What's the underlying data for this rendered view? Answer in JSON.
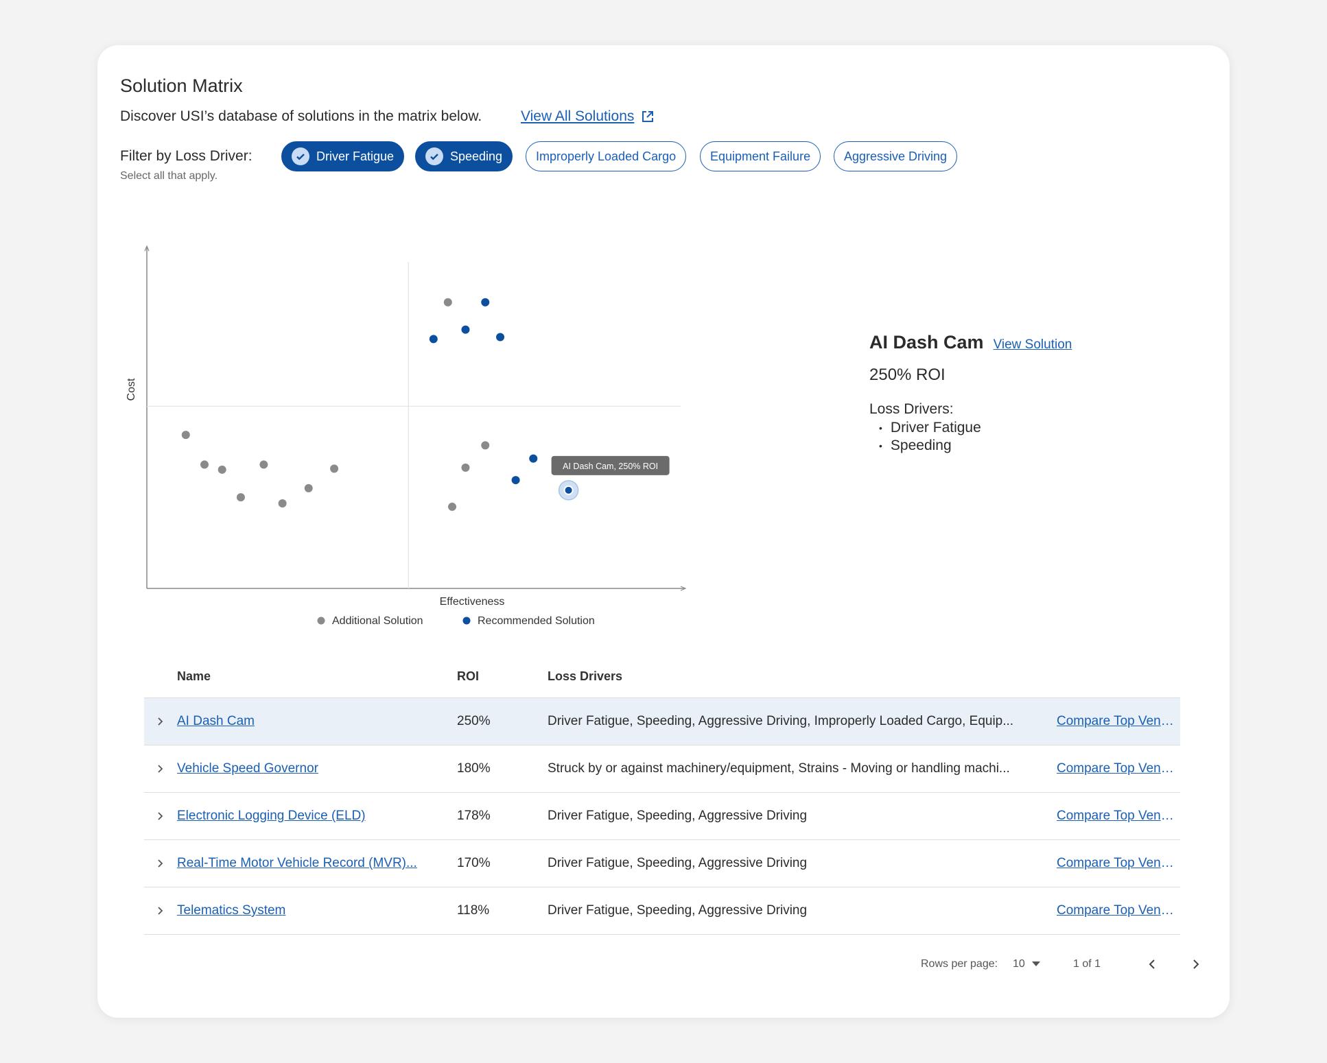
{
  "header": {
    "title": "Solution Matrix",
    "subtitle": "Discover USI’s database of solutions in the matrix below.",
    "view_all_label": "View All Solutions"
  },
  "filters": {
    "label": "Filter by Loss Driver:",
    "hint": "Select all that apply.",
    "chips": [
      {
        "label": "Driver Fatigue",
        "selected": true
      },
      {
        "label": "Speeding",
        "selected": true
      },
      {
        "label": "Improperly Loaded Cargo",
        "selected": false
      },
      {
        "label": "Equipment Failure",
        "selected": false
      },
      {
        "label": "Aggressive Driving",
        "selected": false
      }
    ]
  },
  "chart_data": {
    "type": "scatter",
    "xlabel": "Effectiveness",
    "ylabel": "Cost",
    "xlim": [
      0,
      100
    ],
    "ylim": [
      0,
      100
    ],
    "grid": false,
    "quadrant_lines": {
      "x": 49,
      "y": 54
    },
    "legend_placement": "bottom-center",
    "series": [
      {
        "name": "Additional Solution",
        "color": "#8a8a8a",
        "points": [
          {
            "x": 7.3,
            "y": 45.5
          },
          {
            "x": 10.8,
            "y": 36.7
          },
          {
            "x": 14.1,
            "y": 35.2
          },
          {
            "x": 17.6,
            "y": 27.0
          },
          {
            "x": 21.9,
            "y": 36.7
          },
          {
            "x": 25.4,
            "y": 25.2
          },
          {
            "x": 30.3,
            "y": 29.7
          },
          {
            "x": 35.1,
            "y": 35.5
          },
          {
            "x": 56.4,
            "y": 84.8
          },
          {
            "x": 59.7,
            "y": 35.8
          },
          {
            "x": 57.2,
            "y": 24.2
          },
          {
            "x": 63.4,
            "y": 42.4
          }
        ]
      },
      {
        "name": "Recommended Solution",
        "color": "#0b4f9e",
        "points": [
          {
            "x": 53.7,
            "y": 73.9
          },
          {
            "x": 59.7,
            "y": 76.7
          },
          {
            "x": 63.4,
            "y": 84.8
          },
          {
            "x": 66.2,
            "y": 74.5
          },
          {
            "x": 69.1,
            "y": 32.1
          },
          {
            "x": 72.4,
            "y": 38.5
          },
          {
            "x": 79.0,
            "y": 29.1,
            "active": true
          }
        ]
      }
    ],
    "tooltip": "AI Dash Cam, 250% ROI"
  },
  "detail": {
    "name": "AI Dash Cam",
    "view_label": "View Solution",
    "roi": "250% ROI",
    "loss_drivers_label": "Loss Drivers:",
    "loss_drivers": [
      "Driver Fatigue",
      "Speeding"
    ]
  },
  "table": {
    "columns": {
      "name": "Name",
      "roi": "ROI",
      "loss_drivers": "Loss Drivers"
    },
    "rows": [
      {
        "name": "AI Dash Cam",
        "roi": "250%",
        "loss_drivers": "Driver Fatigue, Speeding, Aggressive Driving, Improperly Loaded Cargo, Equip...",
        "action": "Compare Top Vendors",
        "highlight": true
      },
      {
        "name": "Vehicle Speed Governor",
        "roi": "180%",
        "loss_drivers": "Struck by or against machinery/equipment, Strains - Moving or handling machi...",
        "action": "Compare Top Vendors",
        "highlight": false
      },
      {
        "name": "Electronic Logging Device (ELD)",
        "roi": "178%",
        "loss_drivers": "Driver Fatigue, Speeding, Aggressive Driving",
        "action": "Compare Top Vendors",
        "highlight": false
      },
      {
        "name": "Real-Time Motor Vehicle Record  (MVR)...",
        "roi": "170%",
        "loss_drivers": "Driver Fatigue, Speeding, Aggressive Driving",
        "action": "Compare Top Vendors",
        "highlight": false
      },
      {
        "name": "Telematics System",
        "roi": "118%",
        "loss_drivers": "Driver Fatigue, Speeding, Aggressive Driving",
        "action": "Compare Top Vendors",
        "highlight": false
      }
    ]
  },
  "pagination": {
    "rows_per_page_label": "Rows per page:",
    "rows_per_page": "10",
    "page_info": "1 of 1"
  },
  "colors": {
    "accent": "#1a5fb4",
    "selected_chip": "#0b4f9e",
    "additional": "#8a8a8a",
    "recommended": "#0b4f9e",
    "row_highlight": "#eaf0f7"
  }
}
